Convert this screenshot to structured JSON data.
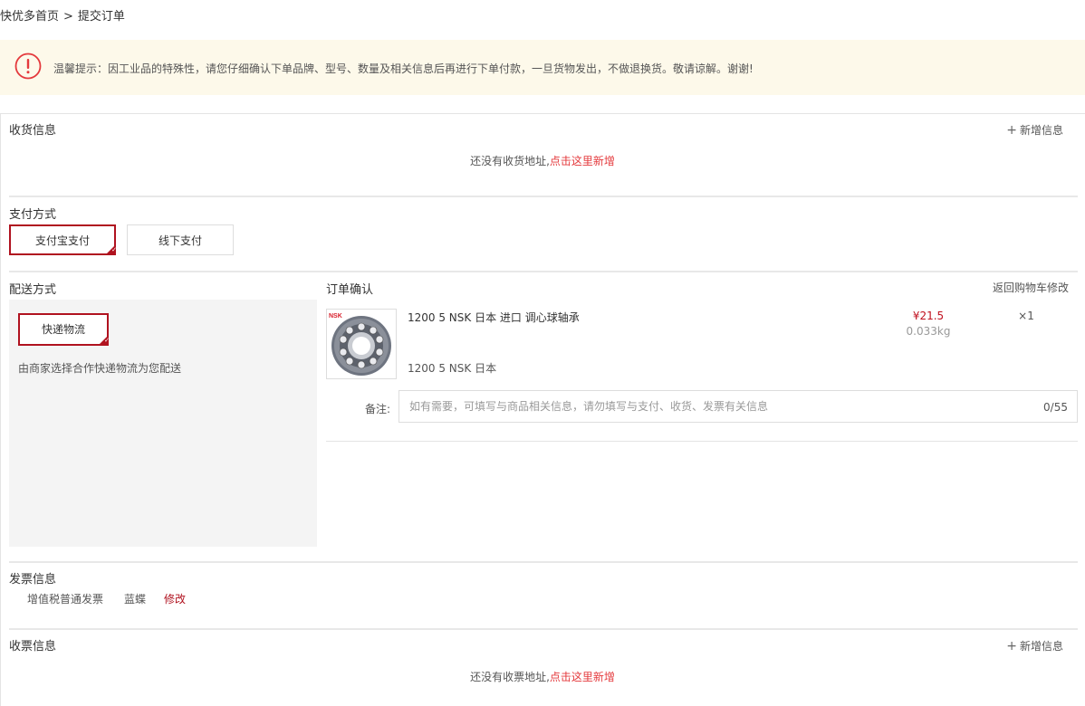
{
  "breadcrumb": {
    "home": "快优多首页",
    "separator": ">",
    "current": "提交订单"
  },
  "notice": {
    "icon": "exclamation-circle-icon",
    "color": "#e4393c",
    "text": "温馨提示：因工业品的特殊性，请您仔细确认下单品牌、型号、数量及相关信息后再进行下单付款，一旦货物发出，不做退换货。敬请谅解。谢谢!"
  },
  "shipping_address": {
    "title": "收货信息",
    "add_label": "新增信息",
    "empty_text": "还没有收货地址,",
    "empty_link": "点击这里新增"
  },
  "payment": {
    "title": "支付方式",
    "options": [
      "支付宝支付",
      "线下支付"
    ],
    "selected": "支付宝支付"
  },
  "delivery": {
    "title": "配送方式",
    "option": "快递物流",
    "description": "由商家选择合作快递物流为您配送"
  },
  "order": {
    "title": "订单确认",
    "back_to_cart": "返回购物车修改",
    "product": {
      "image_brand": "NSK",
      "name": "1200 5 NSK 日本 进口 调心球轴承",
      "spec": "1200 5 NSK 日本",
      "price": "¥21.5",
      "weight": "0.033kg",
      "quantity": "×1"
    },
    "remark": {
      "label": "备注:",
      "placeholder": "如有需要，可填写与商品相关信息，请勿填写与支付、收货、发票有关信息",
      "value": "",
      "counter": "0/55"
    }
  },
  "invoice": {
    "title": "发票信息",
    "type": "增值税普通发票",
    "holder": "蓝蝶",
    "edit_label": "修改"
  },
  "invoice_address": {
    "title": "收票信息",
    "add_label": "新增信息",
    "empty_text": "还没有收票地址,",
    "empty_link": "点击这里新增"
  },
  "colors": {
    "accent": "#b0121f",
    "link": "#e4393c",
    "notice_bg": "#fdf9ea",
    "panel_bg": "#f4f4f4"
  }
}
